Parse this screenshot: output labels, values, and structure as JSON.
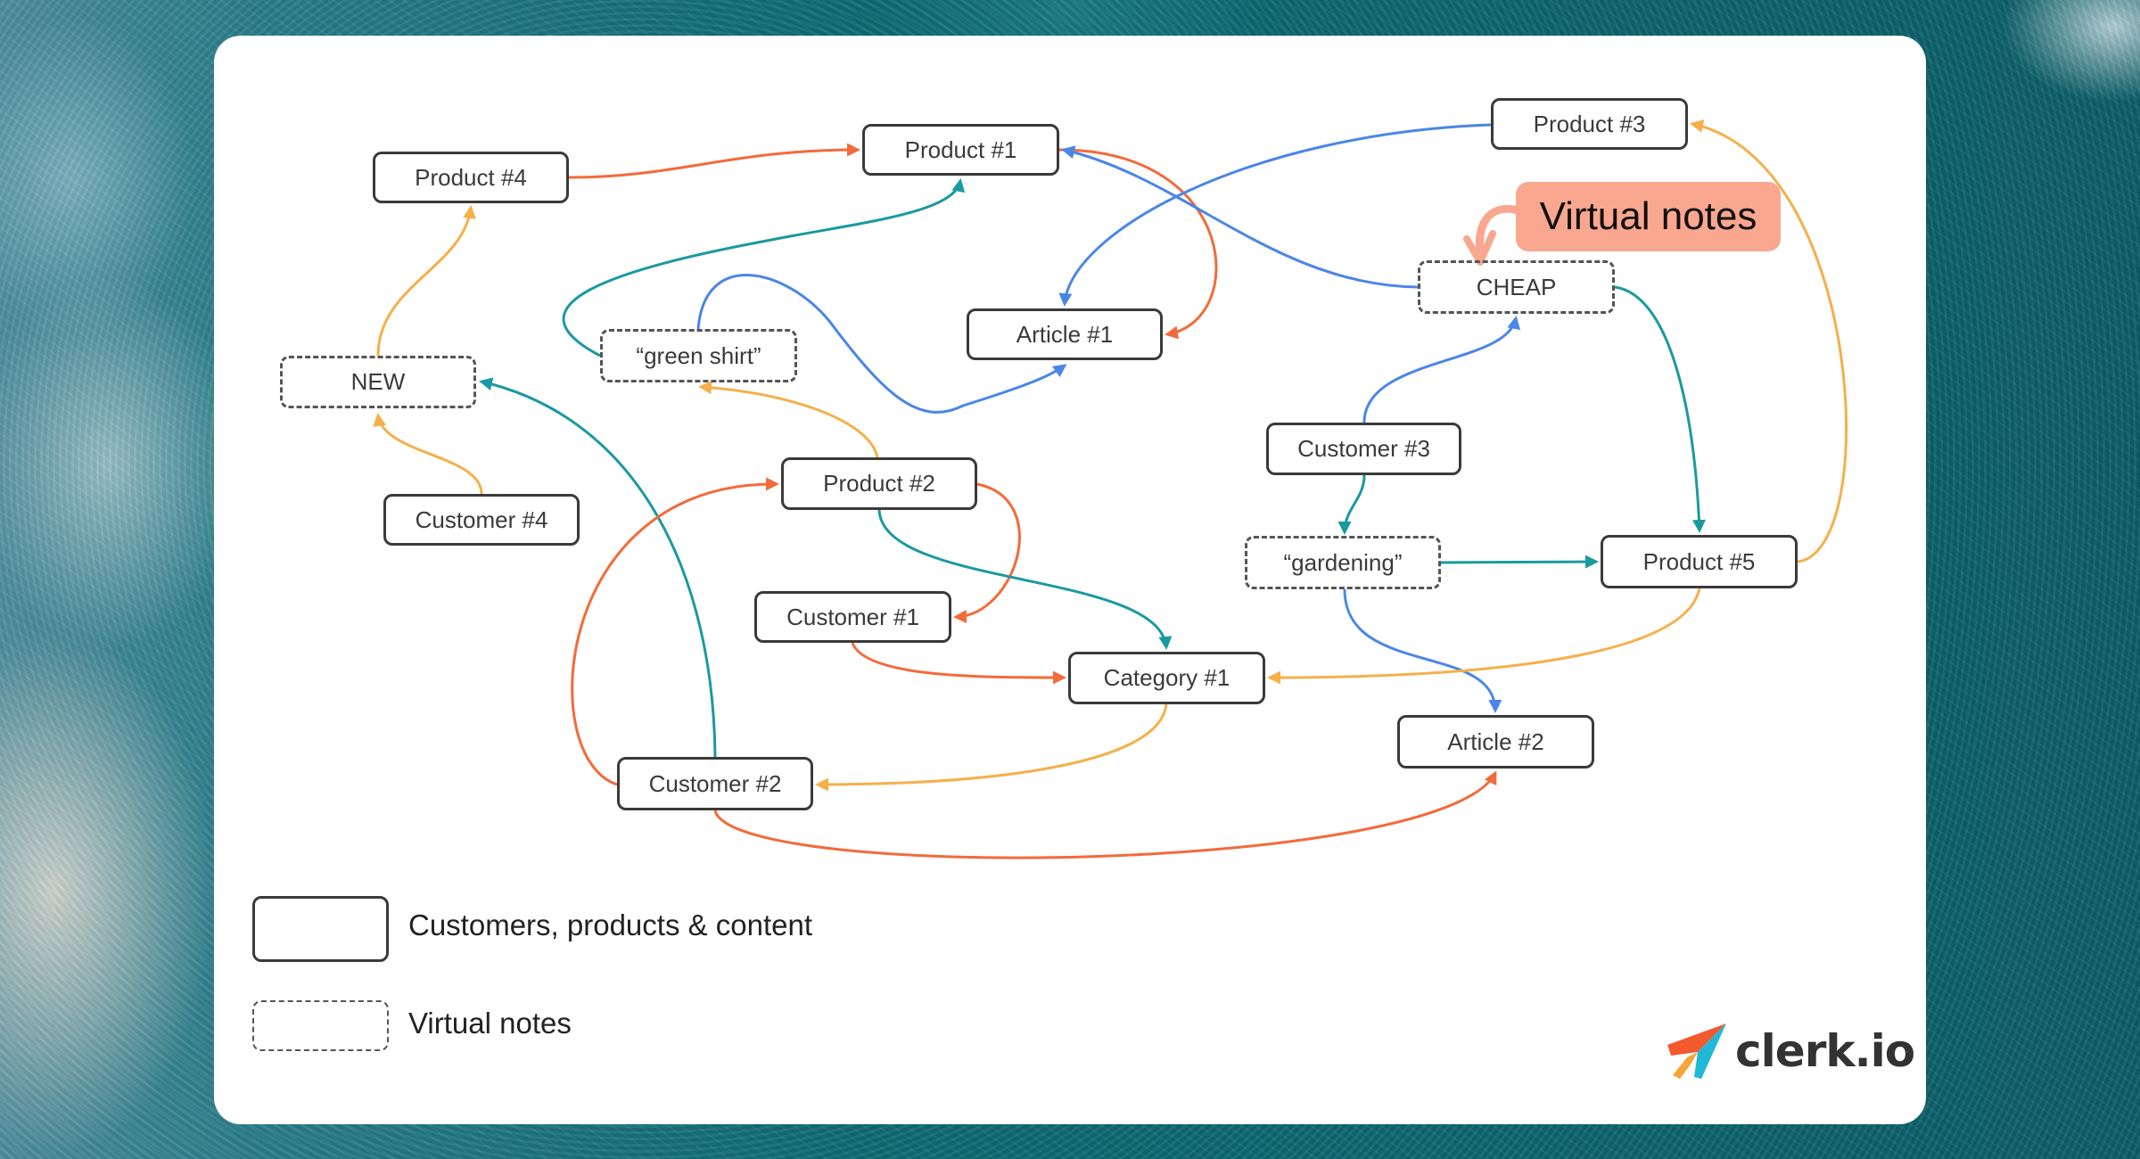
{
  "diagram": {
    "colors": {
      "orange_red": "#F26B3A",
      "teal": "#1A9AA0",
      "blue": "#4A86E8",
      "yellow": "#F5B04A",
      "callout": "#F9A78F",
      "node_border": "#3A3A3A"
    },
    "nodes": [
      {
        "id": "product4",
        "label": "Product #4",
        "kind": "entity"
      },
      {
        "id": "product1",
        "label": "Product #1",
        "kind": "entity"
      },
      {
        "id": "product3",
        "label": "Product #3",
        "kind": "entity"
      },
      {
        "id": "cheap",
        "label": "CHEAP",
        "kind": "virtual"
      },
      {
        "id": "article1",
        "label": "Article #1",
        "kind": "entity"
      },
      {
        "id": "greenshirt",
        "label": "“green shirt”",
        "kind": "virtual"
      },
      {
        "id": "new",
        "label": "NEW",
        "kind": "virtual"
      },
      {
        "id": "customer3",
        "label": "Customer #3",
        "kind": "entity"
      },
      {
        "id": "product2",
        "label": "Product #2",
        "kind": "entity"
      },
      {
        "id": "customer4",
        "label": "Customer #4",
        "kind": "entity"
      },
      {
        "id": "gardening",
        "label": "“gardening”",
        "kind": "virtual"
      },
      {
        "id": "product5",
        "label": "Product #5",
        "kind": "entity"
      },
      {
        "id": "customer1",
        "label": "Customer #1",
        "kind": "entity"
      },
      {
        "id": "category1",
        "label": "Category #1",
        "kind": "entity"
      },
      {
        "id": "article2",
        "label": "Article #2",
        "kind": "entity"
      },
      {
        "id": "customer2",
        "label": "Customer #2",
        "kind": "entity"
      }
    ],
    "edges": [
      {
        "from": "product4",
        "to": "product1",
        "color": "orange_red"
      },
      {
        "from": "new",
        "to": "product4",
        "color": "yellow"
      },
      {
        "from": "customer4",
        "to": "new",
        "color": "yellow"
      },
      {
        "from": "customer2",
        "to": "new",
        "color": "teal"
      },
      {
        "from": "greenshirt",
        "to": "product1",
        "color": "teal"
      },
      {
        "from": "greenshirt",
        "to": "article1",
        "color": "blue"
      },
      {
        "from": "product2",
        "to": "greenshirt",
        "color": "yellow"
      },
      {
        "from": "product1",
        "to": "article1",
        "color": "orange_red"
      },
      {
        "from": "product3",
        "to": "article1",
        "color": "blue"
      },
      {
        "from": "cheap",
        "to": "product1",
        "color": "blue"
      },
      {
        "from": "product5",
        "to": "product3",
        "color": "yellow"
      },
      {
        "from": "cheap",
        "to": "product5",
        "color": "teal"
      },
      {
        "from": "customer3",
        "to": "cheap",
        "color": "blue"
      },
      {
        "from": "customer3",
        "to": "gardening",
        "color": "teal"
      },
      {
        "from": "gardening",
        "to": "product5",
        "color": "teal"
      },
      {
        "from": "gardening",
        "to": "article2",
        "color": "blue"
      },
      {
        "from": "product5",
        "to": "category1",
        "color": "yellow"
      },
      {
        "from": "product2",
        "to": "customer1",
        "color": "orange_red"
      },
      {
        "from": "product2",
        "to": "category1",
        "color": "teal"
      },
      {
        "from": "customer1",
        "to": "category1",
        "color": "orange_red"
      },
      {
        "from": "category1",
        "to": "customer2",
        "color": "yellow"
      },
      {
        "from": "customer2",
        "to": "product2",
        "color": "orange_red"
      },
      {
        "from": "customer2",
        "to": "article2",
        "color": "orange_red"
      }
    ],
    "callout": {
      "label": "Virtual notes",
      "points_to": "cheap"
    }
  },
  "legend": {
    "entity_label": "Customers, products & content",
    "virtual_label": "Virtual notes"
  },
  "brand": {
    "name": "clerk.io",
    "logo_icon": "paper-plane-icon"
  }
}
